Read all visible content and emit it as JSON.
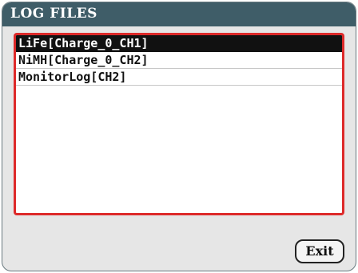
{
  "window": {
    "title": "LOG FILES"
  },
  "log_list": {
    "items": [
      {
        "label": "LiFe[Charge_0_CH1]",
        "selected": true
      },
      {
        "label": "NiMH[Charge_0_CH2]",
        "selected": false
      },
      {
        "label": "MonitorLog[CH2]",
        "selected": false
      }
    ]
  },
  "actions": {
    "exit_label": "Exit"
  },
  "colors": {
    "title_bar": "#3f5d68",
    "list_border": "#dd2a2a",
    "selection": "#111111",
    "background": "#e6e6e6"
  }
}
